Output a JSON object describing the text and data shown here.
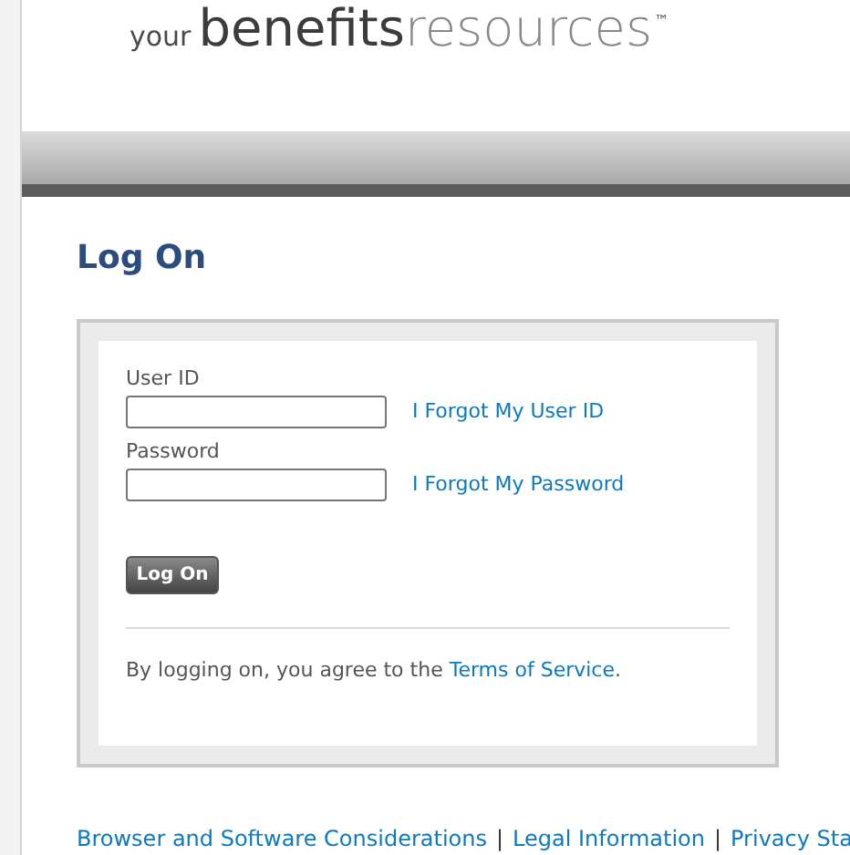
{
  "logo": {
    "prefix": "your",
    "main": "benefits",
    "suffix": "resources",
    "mark": "™"
  },
  "title": "Log On",
  "form": {
    "fields": [
      {
        "label": "User ID",
        "link": "I Forgot My User ID"
      },
      {
        "label": "Password",
        "link": "I Forgot My Password"
      }
    ],
    "button": "Log On",
    "agreement": {
      "text": "By logging on, you agree to the",
      "link": "Terms of Service",
      "end": "."
    }
  },
  "footer_links": [
    "Browser and Software Considerations",
    "Legal Information",
    "Privacy Sta"
  ],
  "footer_separator": "|"
}
